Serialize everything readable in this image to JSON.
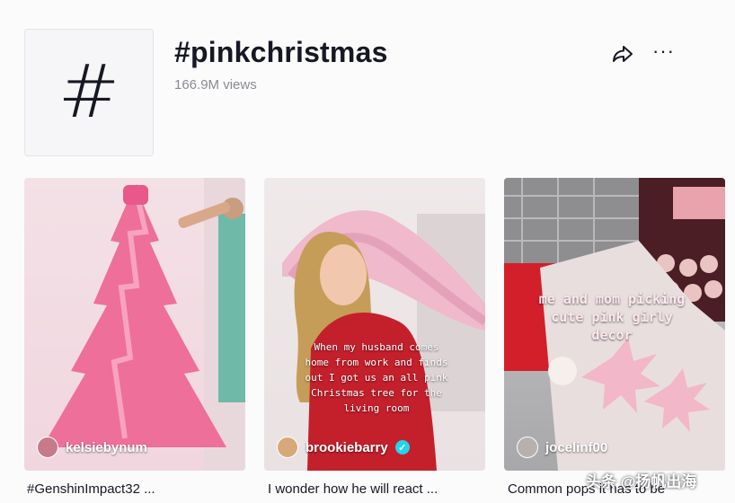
{
  "header": {
    "tag_icon": "hashtag-icon",
    "tag_glyph": "#",
    "title": "#pinkchristmas",
    "views": "166.9M views"
  },
  "actions": {
    "share_icon": "share-arrow-icon",
    "more_icon": "more-dots-icon",
    "more_glyph": "···"
  },
  "videos": [
    {
      "author": "kelsiebynum",
      "caption": "#GenshinImpact32 ...",
      "overlay": ""
    },
    {
      "author": "brookiebarry",
      "verified": true,
      "caption": "I wonder how he will react ...",
      "overlay": "When my husband comes home from work and finds out I got us an all pink Christmas tree for the living room"
    },
    {
      "author": "jocelinf00",
      "caption": "Common pops it has to be",
      "overlay": "me and mom picking cute pink girly decor"
    }
  ],
  "watermark": "头条 @扬帆出海",
  "colors": {
    "text": "#161823",
    "muted": "#8a8b91",
    "pink_tree": "#ee6f99",
    "verified": "#20d5ec"
  }
}
